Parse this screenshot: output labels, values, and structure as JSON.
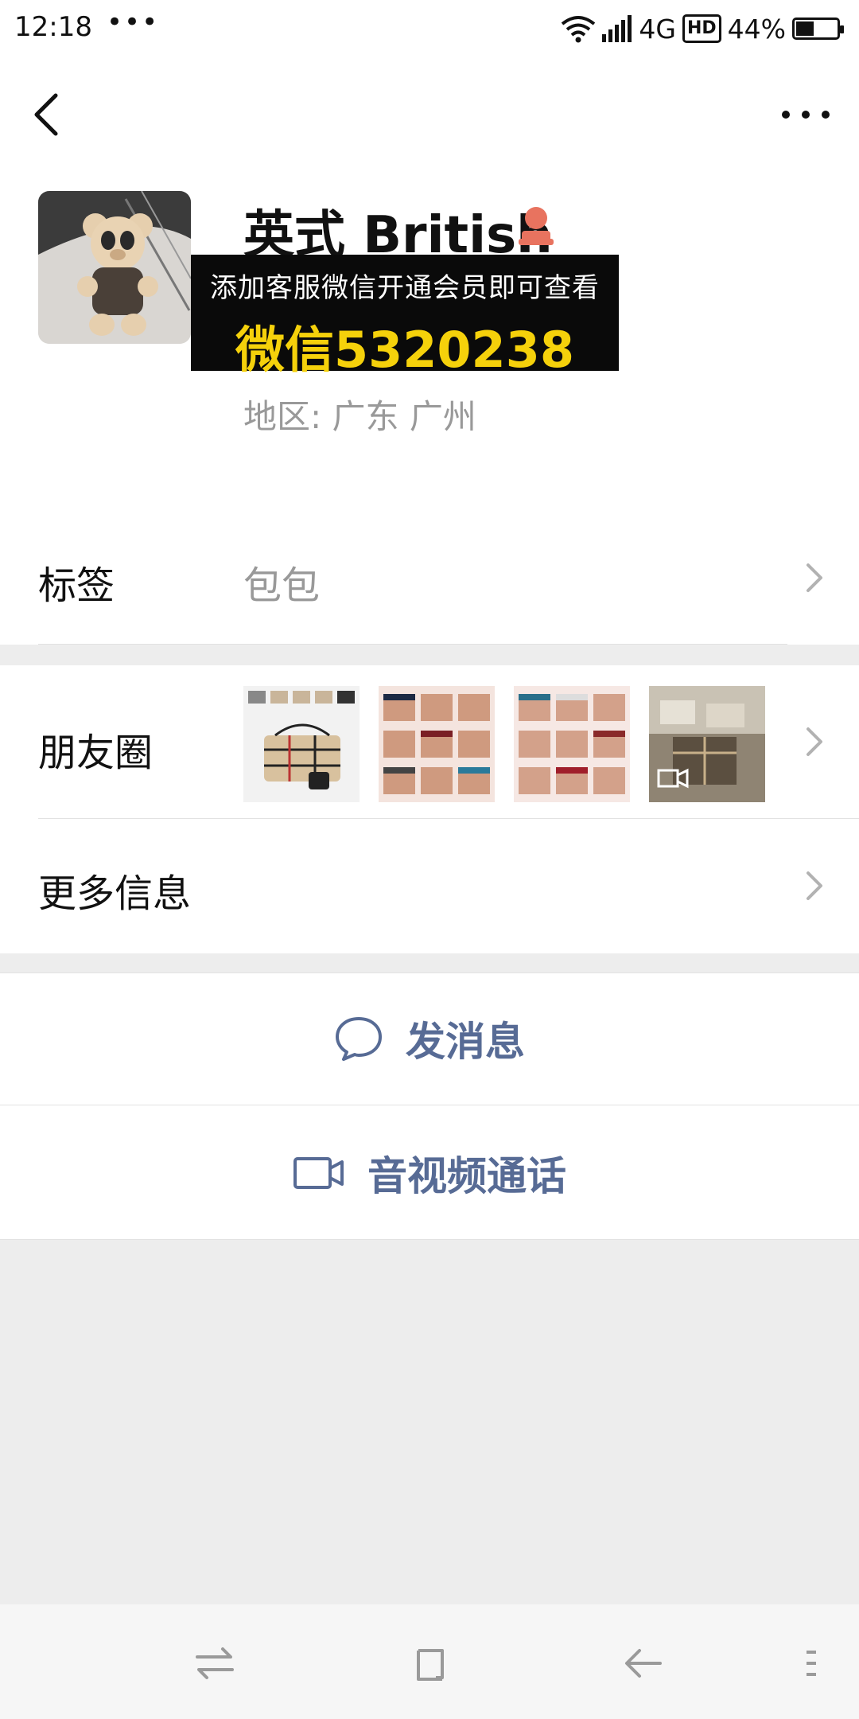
{
  "status_bar": {
    "time": "12:18",
    "notification_dots": "•••",
    "network_type": "4G",
    "hd_label": "HD",
    "battery_percent": "44%",
    "battery_level": 0.44
  },
  "profile": {
    "name": "英式 British",
    "region": "地区:  广东  广州",
    "avatar_icon": "teddy-bear-avatar",
    "gender_icon": "female-icon"
  },
  "promo_banner": {
    "line1": "添加客服微信开通会员即可查看",
    "line2": "微信5320238",
    "background": "#0a0a0a",
    "accent": "#f5d10b"
  },
  "cells": {
    "tags_label": "标签",
    "tags_value": "包包",
    "moments_label": "朋友圈",
    "more_info_label": "更多信息"
  },
  "actions": {
    "message_label": "发消息",
    "video_call_label": "音视频通话",
    "link_color": "#576b95"
  },
  "nav_bar": {
    "icons": [
      "switch-apps-icon",
      "home-square-icon",
      "back-arrow-icon",
      "menu-icon"
    ]
  }
}
